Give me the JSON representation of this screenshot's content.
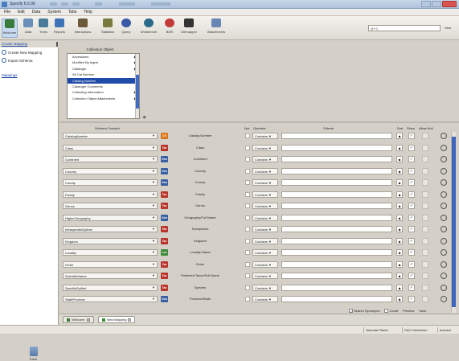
{
  "window": {
    "title": "Specify 6.5.06"
  },
  "menubar": [
    "File",
    "Edit",
    "Data",
    "System",
    "Tabs",
    "Help"
  ],
  "toolbar": {
    "buttons": [
      {
        "label": "Welcome",
        "icon": "home-icon",
        "color": "#3a7a3a"
      },
      {
        "label": "Data",
        "icon": "data-entry-icon",
        "color": "#6a8fb8"
      },
      {
        "label": "Trees",
        "icon": "tree-icon",
        "color": "#4a7a9a"
      },
      {
        "label": "Reports",
        "icon": "reports-icon",
        "color": "#3f73b8"
      },
      {
        "label": "Interactions",
        "icon": "interactions-icon",
        "color": "#6c5a3a"
      },
      {
        "label": "Statistics",
        "icon": "statistics-icon",
        "color": "#7a7a40"
      },
      {
        "label": "Query",
        "icon": "query-icon",
        "color": "#3a5aa8"
      },
      {
        "label": "Workbench",
        "icon": "workbench-icon",
        "color": "#2c6a8a"
      },
      {
        "label": "BGR",
        "icon": "bgr-icon",
        "color": "#c23a3a"
      },
      {
        "label": "Lifemapper",
        "icon": "lifemapper-icon",
        "color": "#333333"
      },
      {
        "label": "Attachments",
        "icon": "attachments-icon",
        "color": "#6a86b4"
      }
    ],
    "search": {
      "value": "Q+ 0",
      "button": "Sear"
    }
  },
  "left_pane": {
    "header": "Create Mapping",
    "items": [
      "Create New Mapping",
      "Import Schema"
    ],
    "link": "Mappings",
    "trash_label": "Trash"
  },
  "collection_object": {
    "header": "Collection Object",
    "items": [
      {
        "label": "Accessions",
        "arrow": true,
        "selected": false
      },
      {
        "label": "Modified By Agent",
        "arrow": true,
        "selected": false
      },
      {
        "label": "Cataloger",
        "arrow": true,
        "selected": false
      },
      {
        "label": "Alt Cat Number",
        "arrow": false,
        "selected": false
      },
      {
        "label": "Catalog Number",
        "arrow": false,
        "selected": true
      },
      {
        "label": "Cataloger Comments",
        "arrow": false,
        "selected": false
      },
      {
        "label": "Collecting Information",
        "arrow": true,
        "selected": false
      },
      {
        "label": "Collection Object Attachments",
        "arrow": true,
        "selected": false
      }
    ]
  },
  "table": {
    "headers": {
      "concept": "Schema Concept",
      "not": "Not",
      "operator": "Operator",
      "criteria": "Criteria",
      "sort": "Sort",
      "show": "Show",
      "allow_null": "Allow Null"
    },
    "rows": [
      {
        "concept": "CatalogNumber",
        "badge": "CO",
        "badge_color": "#d9761a",
        "field": "Catalog Number",
        "operator": "Contains",
        "sort": "◆",
        "show": true
      },
      {
        "concept": "Class",
        "badge": "Tax",
        "badge_color": "#b8352c",
        "field": "Class",
        "operator": "Contains",
        "sort": "◆",
        "show": true
      },
      {
        "concept": "Continent",
        "badge": "Geo",
        "badge_color": "#3a5fa0",
        "field": "Continent",
        "operator": "Contains",
        "sort": "◆",
        "show": true
      },
      {
        "concept": "Country",
        "badge": "Geo",
        "badge_color": "#3a5fa0",
        "field": "Country",
        "operator": "Contains",
        "sort": "◆",
        "show": true
      },
      {
        "concept": "County",
        "badge": "Geo",
        "badge_color": "#3a5fa0",
        "field": "County",
        "operator": "Contains",
        "sort": "◆",
        "show": true
      },
      {
        "concept": "Family",
        "badge": "Tax",
        "badge_color": "#b8352c",
        "field": "Family",
        "operator": "Contains",
        "sort": "◆",
        "show": true
      },
      {
        "concept": "Genus",
        "badge": "Tax",
        "badge_color": "#b8352c",
        "field": "Genus",
        "operator": "Contains",
        "sort": "◆",
        "show": true
      },
      {
        "concept": "HigherGeography",
        "badge": "Geo",
        "badge_color": "#3a5fa0",
        "field": "Geography/Full Name",
        "operator": "Contains",
        "sort": "◆",
        "show": true
      },
      {
        "concept": "InfraspecificEpithet",
        "badge": "Tax",
        "badge_color": "#b8352c",
        "field": "Subspecies",
        "operator": "Contains",
        "sort": "◆",
        "show": true
      },
      {
        "concept": "Kingdom",
        "badge": "Tax",
        "badge_color": "#b8352c",
        "field": "Kingdom",
        "operator": "Contains",
        "sort": "◆",
        "show": true
      },
      {
        "concept": "Locality",
        "badge": "Loc",
        "badge_color": "#3f8a3a",
        "field": "Locality Name",
        "operator": "Contains",
        "sort": "◆",
        "show": true
      },
      {
        "concept": "Order",
        "badge": "Tax",
        "badge_color": "#b8352c",
        "field": "Order",
        "operator": "Contains",
        "sort": "◆",
        "show": true
      },
      {
        "concept": "ScientificName",
        "badge": "Tax",
        "badge_color": "#b8352c",
        "field": "Preferred Taxon/Full Name",
        "operator": "Contains",
        "sort": "◆",
        "show": true
      },
      {
        "concept": "SpecificEpithet",
        "badge": "Tax",
        "badge_color": "#b8352c",
        "field": "Species",
        "operator": "Contains",
        "sort": "◆",
        "show": true
      },
      {
        "concept": "StateProvince",
        "badge": "Geo",
        "badge_color": "#3a5fa0",
        "field": "Province/State",
        "operator": "Contains",
        "sort": "◆",
        "show": true
      }
    ]
  },
  "bottom_options": {
    "search_synonyms": "Search Synonyms",
    "count": "Count",
    "preview": "Preview",
    "save": "Save"
  },
  "tabs": [
    {
      "label": "Welcome"
    },
    {
      "label": "New Mapping"
    }
  ],
  "status": [
    "Vascular Plants",
    "DAO Herbarium",
    "testuser"
  ]
}
